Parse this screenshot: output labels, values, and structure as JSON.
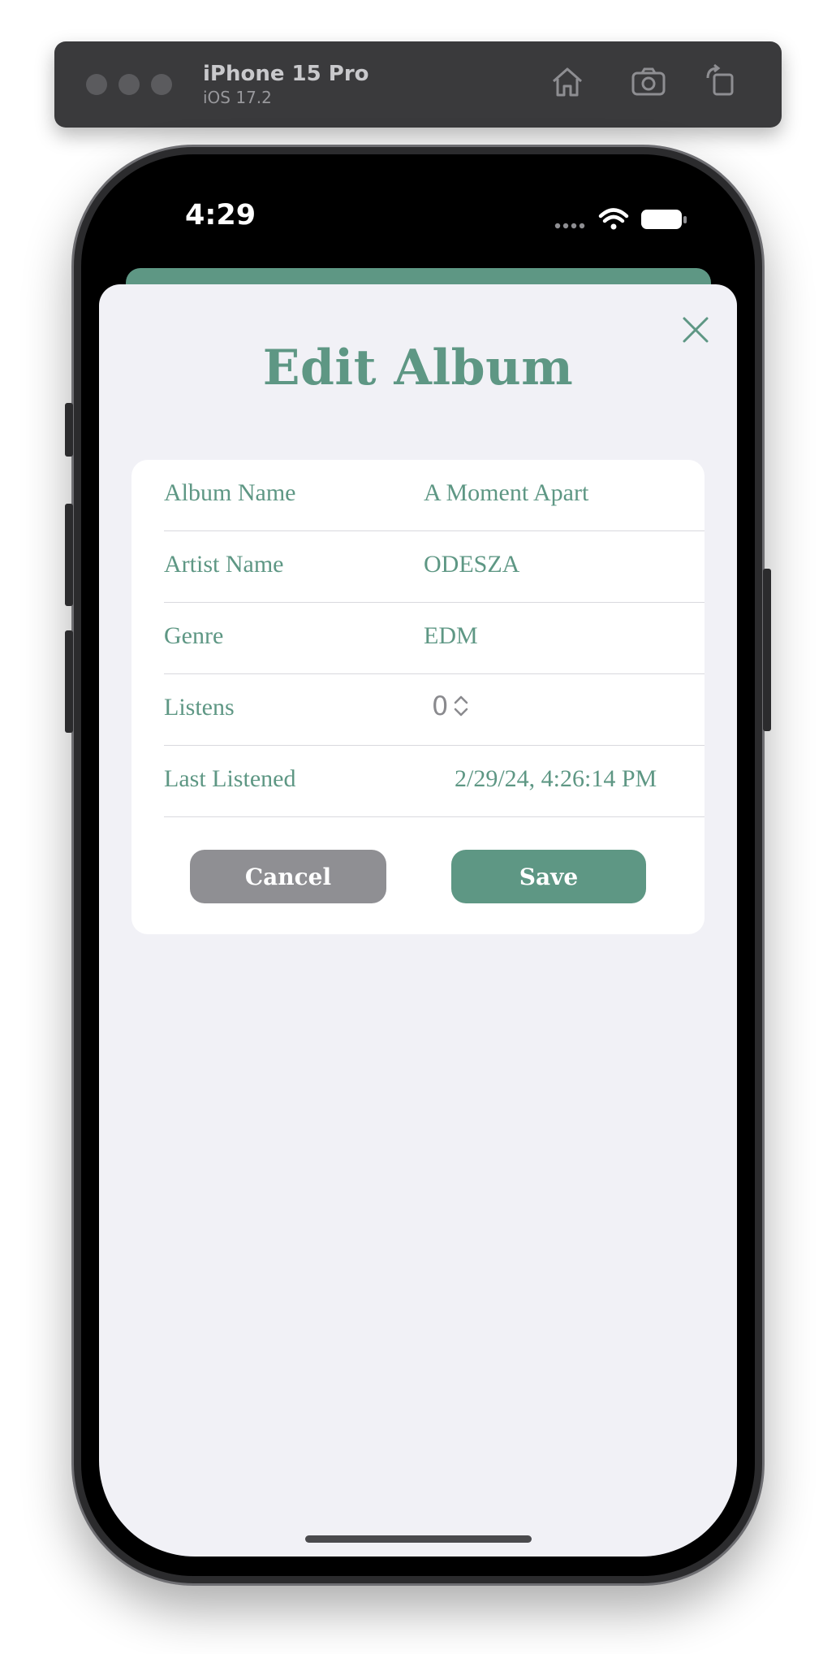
{
  "simulator": {
    "device_name": "iPhone 15 Pro",
    "os_version": "iOS 17.2",
    "toolbar_icons": [
      "home-icon",
      "screenshot-icon",
      "rotate-icon"
    ]
  },
  "status_bar": {
    "time": "4:29",
    "icons": [
      "cellular-signal-icon",
      "wifi-icon",
      "battery-icon"
    ]
  },
  "sheet": {
    "title": "Edit Album",
    "close_icon": "close-icon"
  },
  "form": {
    "rows": [
      {
        "label": "Album Name",
        "value": "A Moment Apart"
      },
      {
        "label": "Artist Name",
        "value": "ODESZA"
      },
      {
        "label": "Genre",
        "value": "EDM"
      },
      {
        "label": "Listens",
        "value": "0"
      },
      {
        "label": "Last Listened",
        "value": "2/29/24, 4:26:14 PM"
      }
    ]
  },
  "buttons": {
    "cancel": "Cancel",
    "save": "Save"
  },
  "colors": {
    "accent": "#5e9784",
    "cancel": "#8f8f93",
    "sheet_background": "#f1f1f6"
  }
}
